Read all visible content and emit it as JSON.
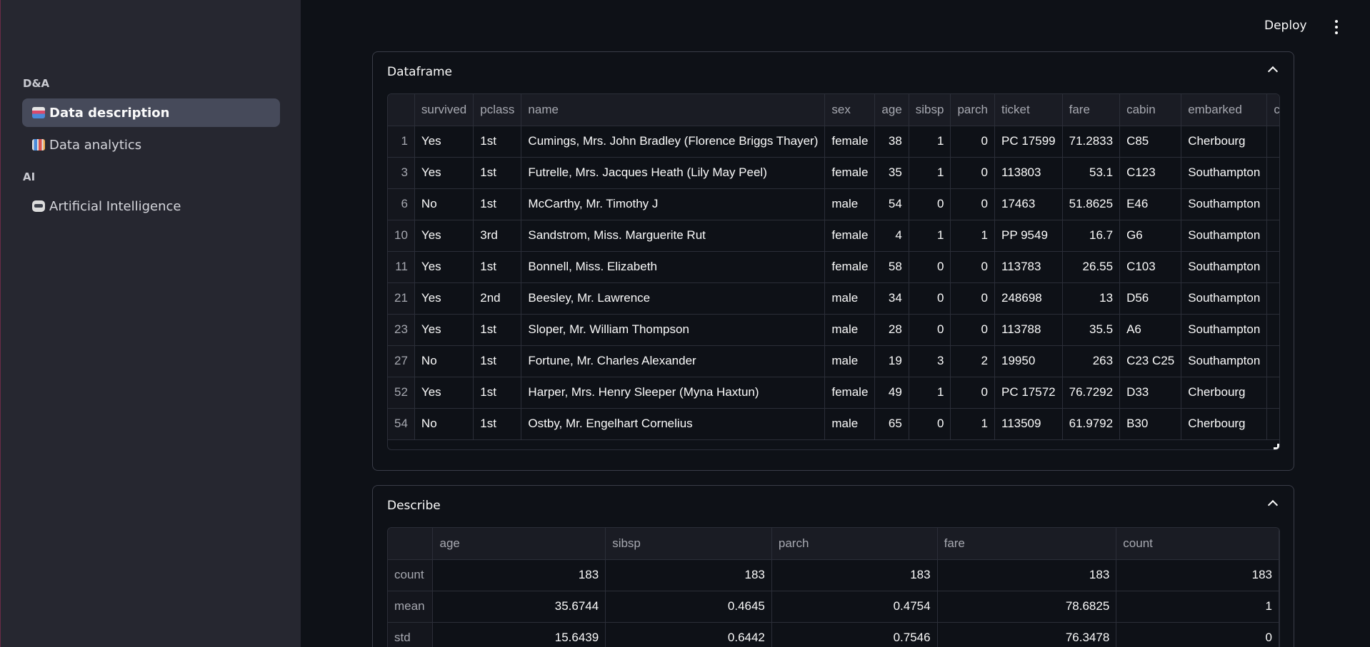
{
  "sidebar": {
    "section_da": "D&A",
    "section_ai": "AI",
    "items": [
      {
        "label": "Data description",
        "icon": "page-with-curl-icon"
      },
      {
        "label": "Data analytics",
        "icon": "bar-chart-icon"
      },
      {
        "label": "Artificial Intelligence",
        "icon": "robot-icon"
      }
    ]
  },
  "topbar": {
    "deploy_label": "Deploy"
  },
  "dataframe": {
    "title": "Dataframe",
    "columns": [
      "survived",
      "pclass",
      "name",
      "sex",
      "age",
      "sibsp",
      "parch",
      "ticket",
      "fare",
      "cabin",
      "embarked",
      "co"
    ],
    "rows": [
      [
        "1",
        "Yes",
        "1st",
        "Cumings, Mrs. John Bradley (Florence Briggs Thayer)",
        "female",
        "38",
        "1",
        "0",
        "PC 17599",
        "71.2833",
        "C85",
        "Cherbourg",
        ""
      ],
      [
        "3",
        "Yes",
        "1st",
        "Futrelle, Mrs. Jacques Heath (Lily May Peel)",
        "female",
        "35",
        "1",
        "0",
        "113803",
        "53.1",
        "C123",
        "Southampton",
        ""
      ],
      [
        "6",
        "No",
        "1st",
        "McCarthy, Mr. Timothy J",
        "male",
        "54",
        "0",
        "0",
        "17463",
        "51.8625",
        "E46",
        "Southampton",
        ""
      ],
      [
        "10",
        "Yes",
        "3rd",
        "Sandstrom, Miss. Marguerite Rut",
        "female",
        "4",
        "1",
        "1",
        "PP 9549",
        "16.7",
        "G6",
        "Southampton",
        ""
      ],
      [
        "11",
        "Yes",
        "1st",
        "Bonnell, Miss. Elizabeth",
        "female",
        "58",
        "0",
        "0",
        "113783",
        "26.55",
        "C103",
        "Southampton",
        ""
      ],
      [
        "21",
        "Yes",
        "2nd",
        "Beesley, Mr. Lawrence",
        "male",
        "34",
        "0",
        "0",
        "248698",
        "13",
        "D56",
        "Southampton",
        ""
      ],
      [
        "23",
        "Yes",
        "1st",
        "Sloper, Mr. William Thompson",
        "male",
        "28",
        "0",
        "0",
        "113788",
        "35.5",
        "A6",
        "Southampton",
        ""
      ],
      [
        "27",
        "No",
        "1st",
        "Fortune, Mr. Charles Alexander",
        "male",
        "19",
        "3",
        "2",
        "19950",
        "263",
        "C23 C25",
        "Southampton",
        ""
      ],
      [
        "52",
        "Yes",
        "1st",
        "Harper, Mrs. Henry Sleeper (Myna Haxtun)",
        "female",
        "49",
        "1",
        "0",
        "PC 17572",
        "76.7292",
        "D33",
        "Cherbourg",
        ""
      ],
      [
        "54",
        "No",
        "1st",
        "Ostby, Mr. Engelhart Cornelius",
        "male",
        "65",
        "0",
        "1",
        "113509",
        "61.9792",
        "B30",
        "Cherbourg",
        ""
      ]
    ]
  },
  "describe": {
    "title": "Describe",
    "columns": [
      "age",
      "sibsp",
      "parch",
      "fare",
      "count"
    ],
    "rows": [
      [
        "count",
        "183",
        "183",
        "183",
        "183",
        "183"
      ],
      [
        "mean",
        "35.6744",
        "0.4645",
        "0.4754",
        "78.6825",
        "1"
      ],
      [
        "std",
        "15.6439",
        "0.6442",
        "0.7546",
        "76.3478",
        "0"
      ]
    ]
  }
}
